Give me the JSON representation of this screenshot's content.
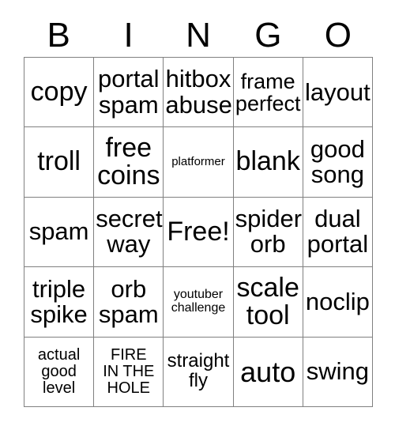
{
  "card": {
    "title": "BINGO",
    "header_letters": [
      "B",
      "I",
      "N",
      "G",
      "O"
    ],
    "free_space_label": "Free!",
    "grid_colors": {
      "border": "#808080",
      "cell_background": "#ffffff",
      "text": "#000000"
    },
    "rows": [
      [
        {
          "text": "copy",
          "size": "lg"
        },
        {
          "text": "portal\nspam",
          "size": "md"
        },
        {
          "text": "hitbox\nabuse",
          "size": "md"
        },
        {
          "text": "frame\nperfect",
          "size": "sm"
        },
        {
          "text": "layout",
          "size": "md"
        }
      ],
      [
        {
          "text": "troll",
          "size": "lg"
        },
        {
          "text": "free\ncoins",
          "size": "lg"
        },
        {
          "text": "platformer",
          "size": "mini"
        },
        {
          "text": "blank",
          "size": "lg"
        },
        {
          "text": "good\nsong",
          "size": "md"
        }
      ],
      [
        {
          "text": "spam",
          "size": "md"
        },
        {
          "text": "secret\nway",
          "size": "md"
        },
        {
          "text": "Free!",
          "size": "lg"
        },
        {
          "text": "spider\norb",
          "size": "md"
        },
        {
          "text": "dual\nportal",
          "size": "md"
        }
      ],
      [
        {
          "text": "triple\nspike",
          "size": "md"
        },
        {
          "text": "orb\nspam",
          "size": "md"
        },
        {
          "text": "youtuber\nchallenge",
          "size": "tiny"
        },
        {
          "text": "scale\ntool",
          "size": "lg"
        },
        {
          "text": "noclip",
          "size": "md"
        }
      ],
      [
        {
          "text": "actual\ngood\nlevel",
          "size": "xxs"
        },
        {
          "text": "FIRE\nIN THE\nHOLE",
          "size": "xxs"
        },
        {
          "text": "straight\nfly",
          "size": "xs"
        },
        {
          "text": "auto",
          "size": "xl"
        },
        {
          "text": "swing",
          "size": "md"
        }
      ]
    ]
  }
}
